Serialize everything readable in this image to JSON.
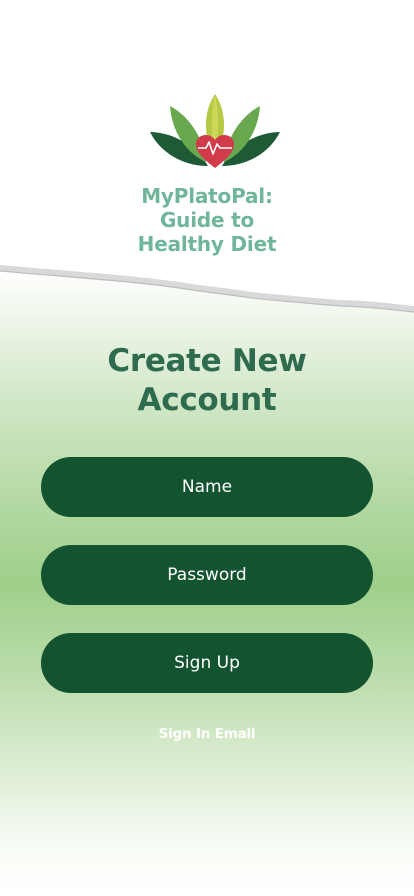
{
  "app": {
    "title_lines": [
      "MyPlatoPal:",
      "Guide to",
      "Healthy Diet"
    ]
  },
  "heading": {
    "lines": [
      "Create New",
      "Account"
    ]
  },
  "form": {
    "name_placeholder": "Name",
    "password_placeholder": "Password",
    "signup_label": "Sign Up",
    "signin_link": "Sign In Email"
  },
  "icons": {
    "logo": "lotus-heart-logo-icon"
  },
  "colors": {
    "title": "#6fb69b",
    "heading": "#2e6b4f",
    "button": "#14532f",
    "button_text": "#ffffff",
    "gradient_green": "#9fcf8a"
  }
}
